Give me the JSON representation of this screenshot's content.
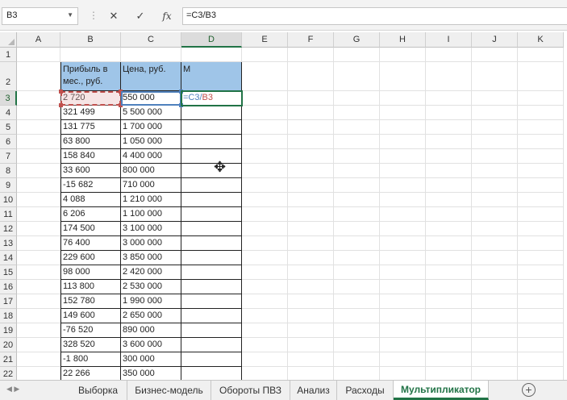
{
  "formula_bar": {
    "name_box": "B3",
    "cancel_icon": "✕",
    "enter_icon": "✓",
    "fx_label": "fx",
    "formula": "=C3/B3"
  },
  "columns": [
    "A",
    "B",
    "C",
    "D",
    "E",
    "F",
    "G",
    "H",
    "I",
    "J",
    "K"
  ],
  "active_column": "D",
  "rows": [
    "1",
    "2",
    "3",
    "4",
    "5",
    "6",
    "7",
    "8",
    "9",
    "10",
    "11",
    "12",
    "13",
    "14",
    "15",
    "16",
    "17",
    "18",
    "19",
    "20",
    "21",
    "22"
  ],
  "active_row": "3",
  "table": {
    "headers": {
      "B": "Прибыль в мес., руб.",
      "C": "Цена, руб.",
      "D": "M"
    },
    "B": [
      "2 720",
      "321 499",
      "131 775",
      "63 800",
      "158 840",
      "33 600",
      "-15 682",
      "4 088",
      "6 206",
      "174 500",
      "76 400",
      "229 600",
      "98 000",
      "113 800",
      "152 780",
      "149 600",
      "-76 520",
      "328 520",
      "-1 800",
      "22 266"
    ],
    "C": [
      "550 000",
      "5 500 000",
      "1 700 000",
      "1 050 000",
      "4 400 000",
      "800 000",
      "710 000",
      "1 210 000",
      "1 100 000",
      "3 100 000",
      "3 000 000",
      "3 850 000",
      "2 420 000",
      "2 530 000",
      "1 990 000",
      "2 650 000",
      "890 000",
      "3 600 000",
      "300 000",
      "350 000"
    ],
    "editing_cell": {
      "prefix": "=C3/",
      "ref": "B3"
    },
    "ref_colors": {
      "B3": "#c0504d",
      "C3": "#4f81bd",
      "header_fill": "#9fc5e8"
    }
  },
  "sheet_tabs": [
    {
      "label": "Выборка",
      "active": false
    },
    {
      "label": "Бизнес-модель",
      "active": false
    },
    {
      "label": "Обороты ПВЗ",
      "active": false
    },
    {
      "label": "Анализ",
      "active": false
    },
    {
      "label": "Расходы",
      "active": false
    },
    {
      "label": "Мультипликатор",
      "active": true
    }
  ],
  "add_sheet_icon": "+"
}
